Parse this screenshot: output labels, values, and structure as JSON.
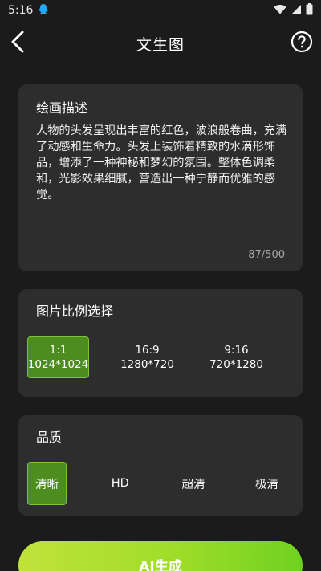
{
  "status": {
    "time": "5:16"
  },
  "header": {
    "title": "文生图"
  },
  "description": {
    "label": "绘画描述",
    "text": "人物的头发呈现出丰富的红色，波浪般卷曲，充满了动感和生命力。头发上装饰着精致的水滴形饰品，增添了一种神秘和梦幻的氛围。整体色调柔和，光影效果细腻，营造出一种宁静而优雅的感觉。",
    "count": "87/500"
  },
  "ratio": {
    "label": "图片比例选择",
    "options": [
      {
        "ratio": "1:1",
        "size": "1024*1024",
        "selected": true
      },
      {
        "ratio": "16:9",
        "size": "1280*720",
        "selected": false
      },
      {
        "ratio": "9:16",
        "size": "720*1280",
        "selected": false
      }
    ]
  },
  "quality": {
    "label": "品质",
    "options": [
      {
        "label": "清晰",
        "selected": true
      },
      {
        "label": "HD",
        "selected": false
      },
      {
        "label": "超清",
        "selected": false
      },
      {
        "label": "极清",
        "selected": false
      }
    ]
  },
  "generate": {
    "label": "AI生成"
  },
  "colors": {
    "accent": "#4d8c1e",
    "accent_border": "#7cc33c",
    "card": "#2d2d2d",
    "background": "#1b1b1b"
  }
}
